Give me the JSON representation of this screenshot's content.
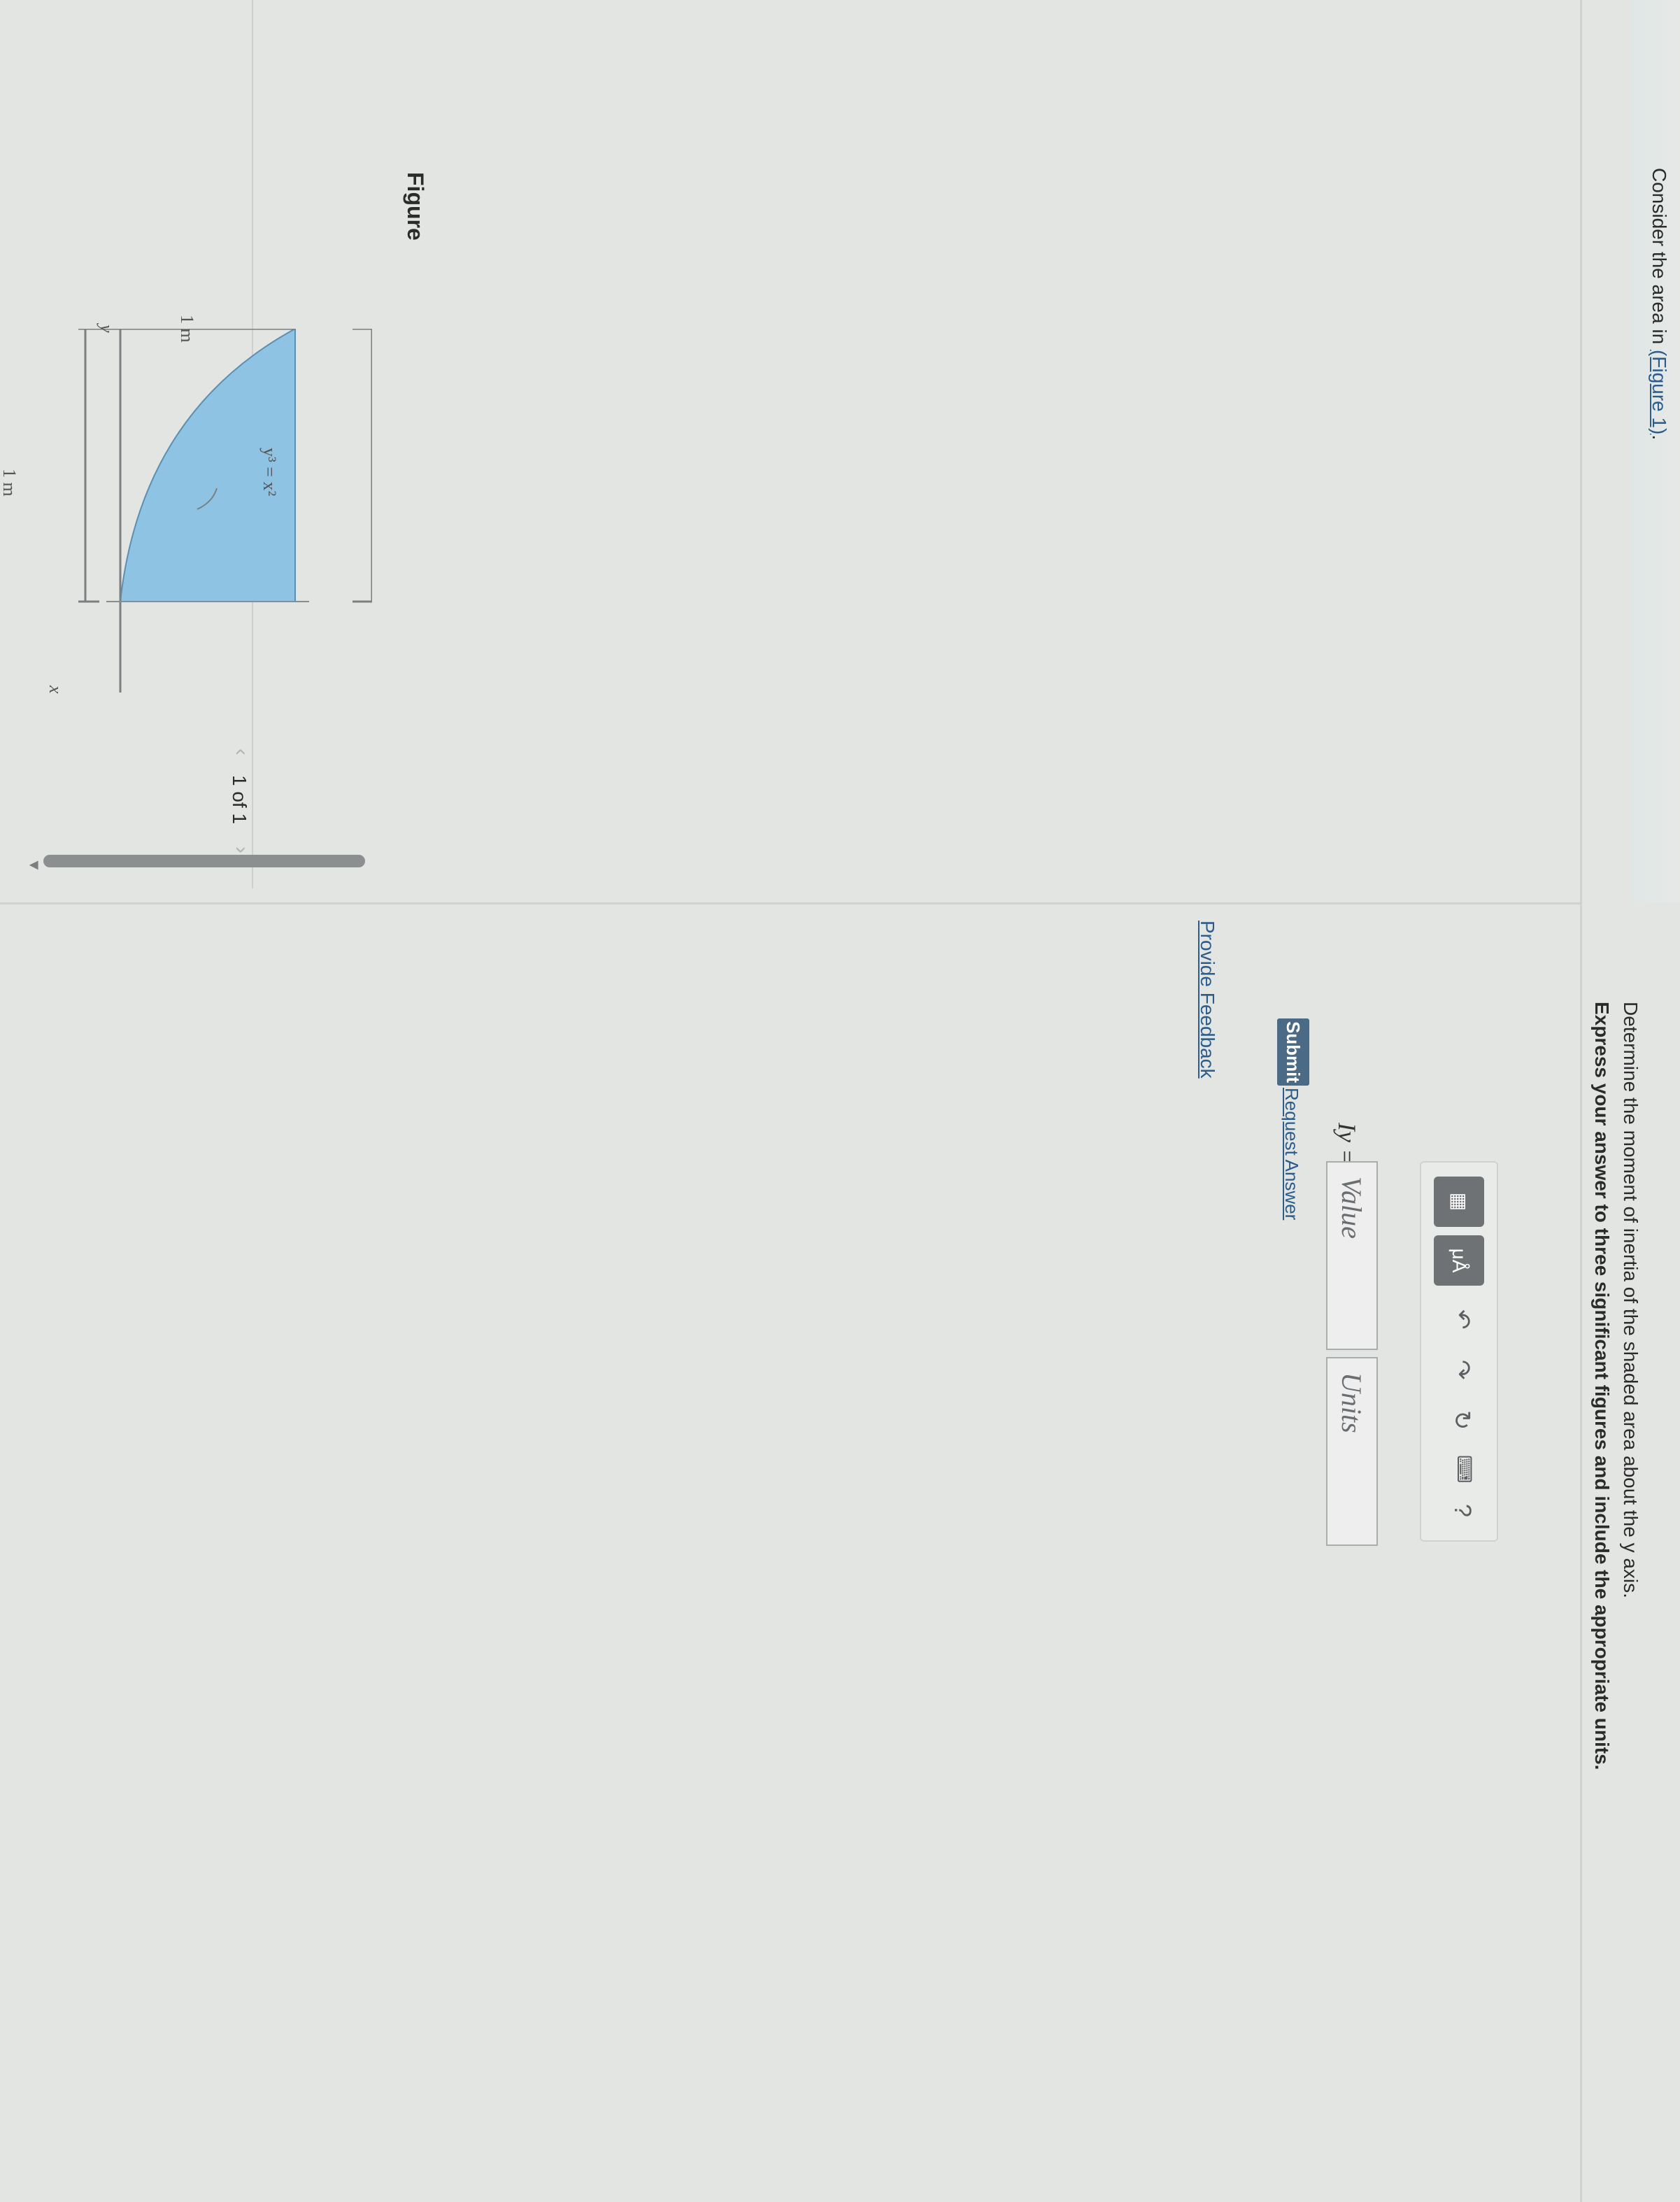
{
  "intro": {
    "prefix": "Consider the area in ",
    "figure_link": "(Figure 1)",
    "suffix": "."
  },
  "figure_panel": {
    "heading": "Figure",
    "pager": "1 of 1",
    "figure": {
      "axis_y_label": "y",
      "axis_x_label": "x",
      "dim_height": "1 m",
      "dim_width": "1 m",
      "curve_label": "y³ = x²",
      "fill_color": "#8ec3e3"
    }
  },
  "question": {
    "prompt": "Determine the moment of inertia of the shaded area about the y axis.",
    "instruction": "Express your answer to three significant figures and include the appropriate units.",
    "answer_label": "Iy =",
    "value_placeholder": "Value",
    "units_placeholder": "Units",
    "toolbar": {
      "template_icon": "templates-icon",
      "units_button": "μÅ",
      "undo_icon": "undo-icon",
      "redo_icon": "redo-icon",
      "reset_icon": "reset-icon",
      "keyboard_icon": "keyboard-icon",
      "help": "?"
    },
    "submit": "Submit",
    "request_answer": "Request Answer"
  },
  "footer": {
    "feedback": "Provide Feedback"
  }
}
